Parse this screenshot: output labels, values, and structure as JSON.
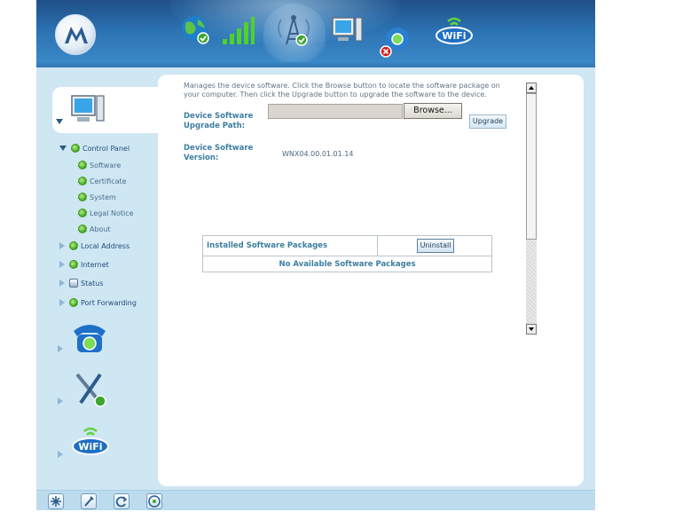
{
  "header": {
    "brand_icon": "motorola-logo-icon",
    "nav_icons": [
      "globe-check-icon",
      "signal-bars-icon",
      "radio-tower-icon",
      "computer-monitor-icon",
      "phone-disconnect-icon",
      "wifi-icon"
    ],
    "active_nav": "radio-tower-icon",
    "wifi_text": "WiFi"
  },
  "sidebar": {
    "device_icon": "computer-monitor-icon",
    "tree": [
      {
        "label": "Control Panel",
        "expanded": true,
        "children": [
          {
            "label": "Software"
          },
          {
            "label": "Certificate"
          },
          {
            "label": "System"
          },
          {
            "label": "Legal Notice"
          },
          {
            "label": "About"
          }
        ]
      },
      {
        "label": "Local Address"
      },
      {
        "label": "Internet"
      },
      {
        "label": "Status"
      },
      {
        "label": "Port Forwarding"
      }
    ],
    "sections": [
      "telephone-icon",
      "tools-icon",
      "wifi-icon"
    ],
    "wifi_text": "WiFi"
  },
  "main": {
    "description": "Manages the device software. Click the Browse button to locate the software package on your computer. Then click the Upgrade button to upgrade the software to the device.",
    "upgrade_path_label": "Device Software Upgrade Path:",
    "upgrade_path_value": "",
    "browse_label": "Browse...",
    "upgrade_label": "Upgrade",
    "version_label": "Device Software Version:",
    "version_value": "WNX04.00.01.01.14",
    "packages_header": "Installed Software Packages",
    "uninstall_label": "Uninstall",
    "no_packages_text": "No Available Software Packages"
  },
  "bottom_bar": {
    "icons": [
      "snowflake-icon",
      "wrench-icon",
      "refresh-icon",
      "help-icon"
    ]
  },
  "colors": {
    "header_blue": "#2c72b2",
    "sidebar_bg": "#cfe6f3",
    "label_blue": "#3d7ea0",
    "gear_green": "#4caf2a"
  }
}
